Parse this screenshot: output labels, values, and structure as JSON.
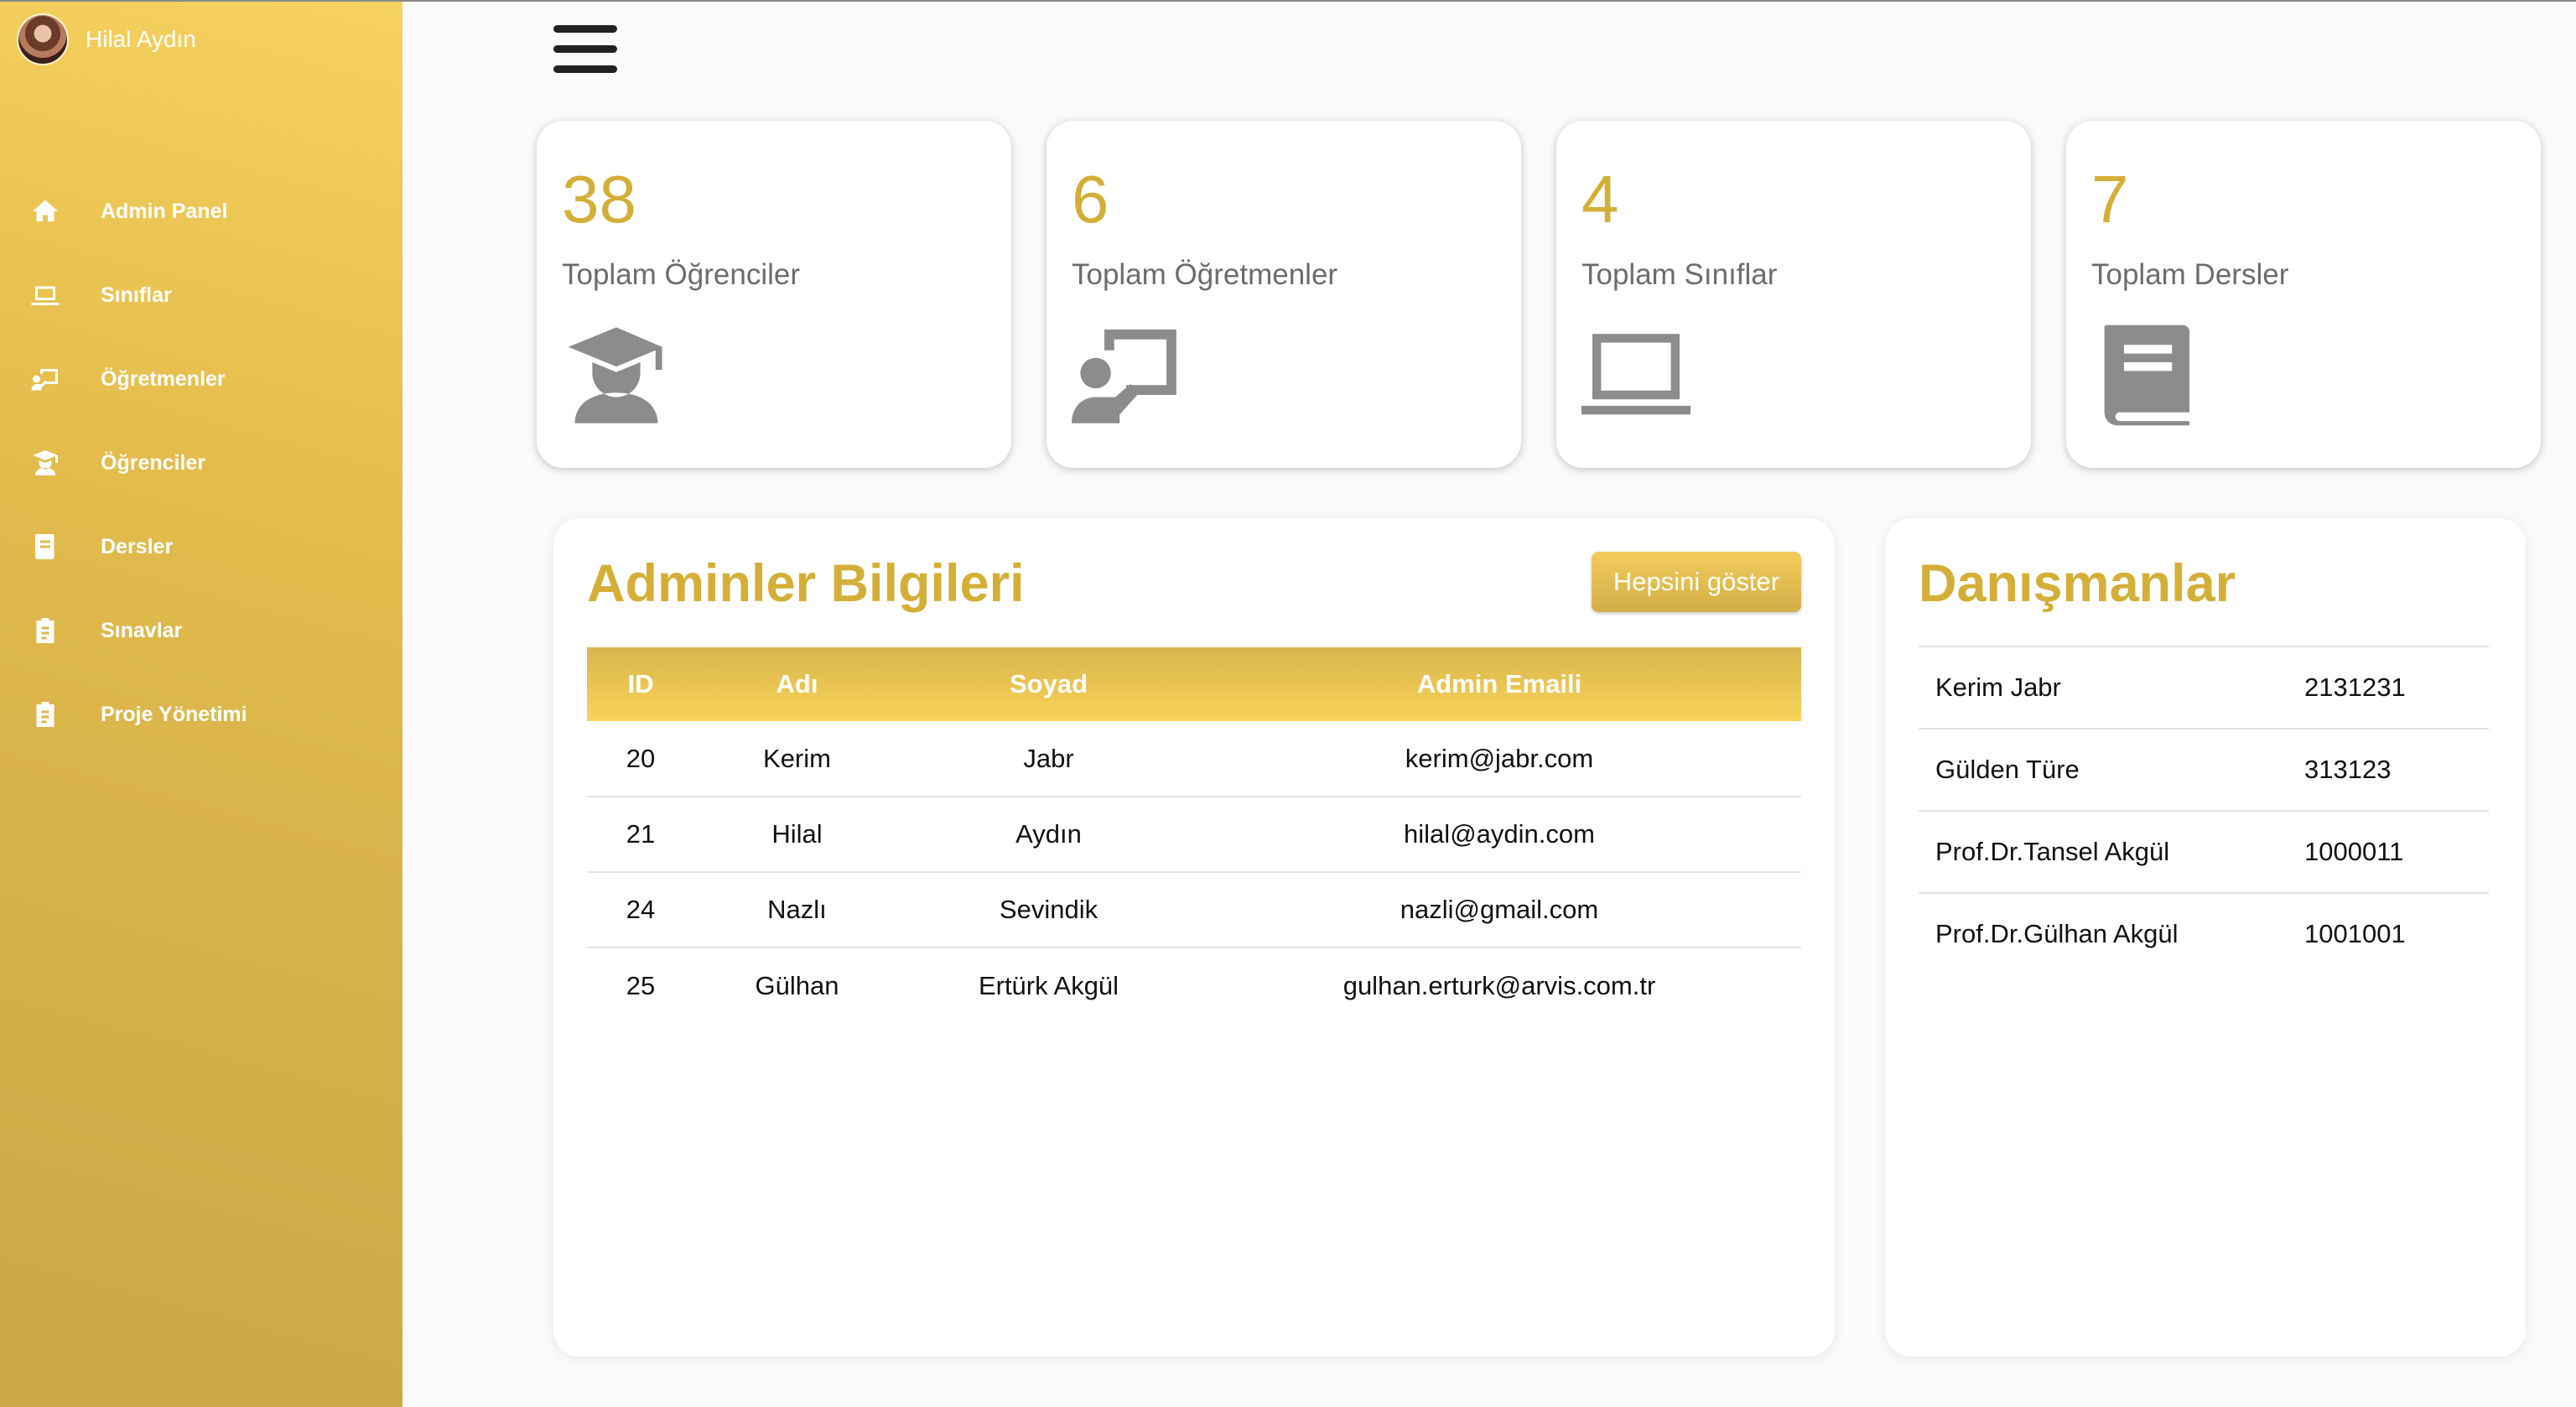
{
  "profile": {
    "name": "Hilal Aydın"
  },
  "sidebar": {
    "items": [
      {
        "label": "Admin Panel",
        "icon": "home-icon"
      },
      {
        "label": "Sınıflar",
        "icon": "laptop-icon"
      },
      {
        "label": "Öğretmenler",
        "icon": "teacher-icon"
      },
      {
        "label": "Öğrenciler",
        "icon": "student-icon"
      },
      {
        "label": "Dersler",
        "icon": "book-icon"
      },
      {
        "label": "Sınavlar",
        "icon": "clipboard-icon"
      },
      {
        "label": "Proje Yönetimi",
        "icon": "clipboard-icon"
      }
    ]
  },
  "stats": [
    {
      "value": "38",
      "label": "Toplam Öğrenciler",
      "icon": "graduate-icon"
    },
    {
      "value": "6",
      "label": "Toplam Öğretmenler",
      "icon": "teacher-icon"
    },
    {
      "value": "4",
      "label": "Toplam Sınıflar",
      "icon": "laptop-icon"
    },
    {
      "value": "7",
      "label": "Toplam Dersler",
      "icon": "book-icon"
    }
  ],
  "admins": {
    "title": "Adminler Bilgileri",
    "show_all": "Hepsini göster",
    "columns": [
      "ID",
      "Adı",
      "Soyad",
      "Admin Emaili"
    ],
    "rows": [
      [
        "20",
        "Kerim",
        "Jabr",
        "kerim@jabr.com"
      ],
      [
        "21",
        "Hilal",
        "Aydın",
        "hilal@aydin.com"
      ],
      [
        "24",
        "Nazlı",
        "Sevindik",
        "nazli@gmail.com"
      ],
      [
        "25",
        "Gülhan",
        "Ertürk Akgül",
        "gulhan.erturk@arvis.com.tr"
      ]
    ]
  },
  "advisors": {
    "title": "Danışmanlar",
    "rows": [
      {
        "name": "Kerim Jabr",
        "id": "2131231"
      },
      {
        "name": "Gülden Türe",
        "id": "313123"
      },
      {
        "name": "Prof.Dr.Tansel Akgül",
        "id": "1000011"
      },
      {
        "name": "Prof.Dr.Gülhan Akgül",
        "id": "1001001"
      }
    ]
  },
  "colors": {
    "accent": "#d4af37",
    "sidebar": "#e3bc4c",
    "icon_gray": "#8c8c8c"
  }
}
